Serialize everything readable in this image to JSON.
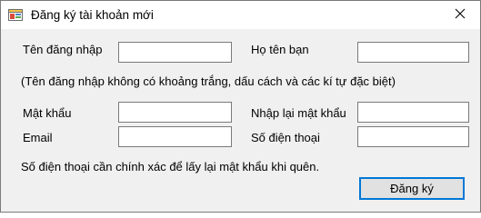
{
  "window": {
    "title": "Đăng ký tài khoản mới",
    "icon": "app-form-icon"
  },
  "form": {
    "username_label": "Tên đăng nhập",
    "fullname_label": "Họ tên bạn",
    "username_hint": "(Tên đăng nhập không có khoảng trắng, dấu cách và các kí tự đặc biệt)",
    "password_label": "Mật khẩu",
    "confirm_password_label": "Nhập lại mật khẩu",
    "email_label": "Email",
    "phone_label": "Số điện thoại",
    "phone_note": "Số điện thoại cần chính xác để lấy lại mật khẩu khi quên.",
    "submit_label": "Đăng ký",
    "username_value": "",
    "fullname_value": "",
    "password_value": "",
    "confirm_password_value": "",
    "email_value": "",
    "phone_value": ""
  },
  "colors": {
    "accent": "#0078d7",
    "client_bg": "#f0f0f0",
    "button_bg": "#e1e1e1"
  }
}
